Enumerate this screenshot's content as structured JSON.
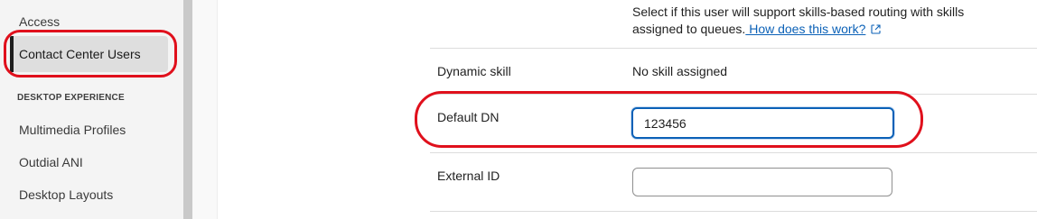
{
  "sidebar": {
    "items_top": [
      {
        "label": "Access"
      }
    ],
    "active_item": {
      "label": "Contact Center Users"
    },
    "section_header": "DESKTOP EXPERIENCE",
    "items_section": [
      {
        "label": "Multimedia Profiles"
      },
      {
        "label": "Outdial ANI"
      },
      {
        "label": "Desktop Layouts"
      }
    ]
  },
  "main": {
    "skills_description": {
      "text": "Select if this user will support skills-based routing with skills assigned to queues.",
      "link_label": " How does this work?",
      "link_icon": "external-link-icon"
    },
    "dynamic_skill": {
      "label": "Dynamic skill",
      "value": "No skill assigned"
    },
    "default_dn": {
      "label": "Default DN",
      "value": "123456"
    },
    "external_id": {
      "label": "External ID",
      "value": ""
    }
  },
  "colors": {
    "annotation": "#e0101c",
    "link": "#0b61b7",
    "focus_border": "#0b61b7"
  }
}
